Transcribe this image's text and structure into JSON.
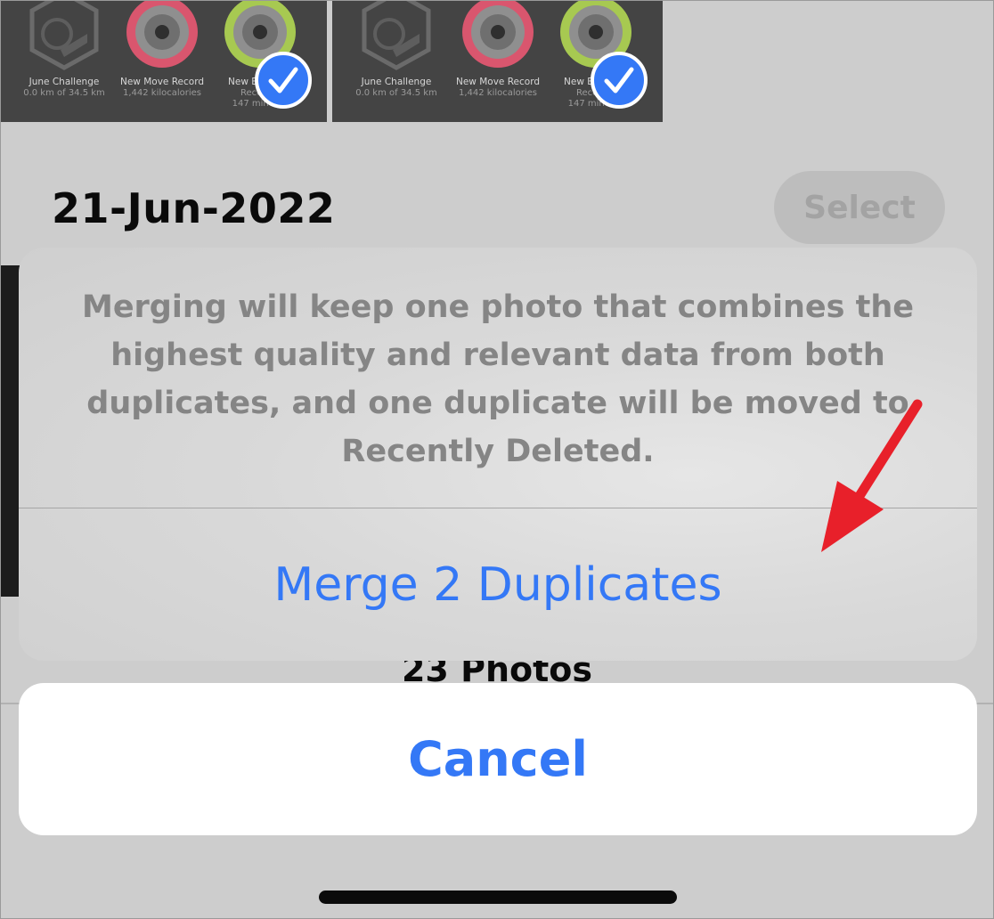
{
  "thumbnails": [
    {
      "awards": [
        {
          "name": "June Challenge",
          "detail": "0.0 km of 34.5 km",
          "extra": ""
        },
        {
          "name": "New Move Record",
          "detail": "1,442 kilocalories",
          "extra": ""
        },
        {
          "name": "New Exercise Record",
          "detail": "Record",
          "extra": "147 minutes"
        }
      ],
      "selected": true
    },
    {
      "awards": [
        {
          "name": "June Challenge",
          "detail": "0.0 km of 34.5 km",
          "extra": ""
        },
        {
          "name": "New Move Record",
          "detail": "1,442 kilocalories",
          "extra": ""
        },
        {
          "name": "New Exercise Record",
          "detail": "Record",
          "extra": "147 minutes"
        }
      ],
      "selected": true
    }
  ],
  "group": {
    "date": "21-Jun-2022",
    "select_label": "Select",
    "photo_count": "23 Photos"
  },
  "action_sheet": {
    "message": "Merging will keep one photo that combines the highest quality and relevant data from both duplicates, and one duplicate will be moved to Recently Deleted.",
    "merge_label": "Merge 2 Duplicates",
    "cancel_label": "Cancel"
  },
  "colors": {
    "accent": "#3478f6",
    "annotation_arrow": "#e8202a"
  },
  "icons": [
    "hexagon-badge-icon",
    "move-ring-icon",
    "exercise-ring-icon",
    "checkmark-icon",
    "annotation-arrow-icon"
  ]
}
